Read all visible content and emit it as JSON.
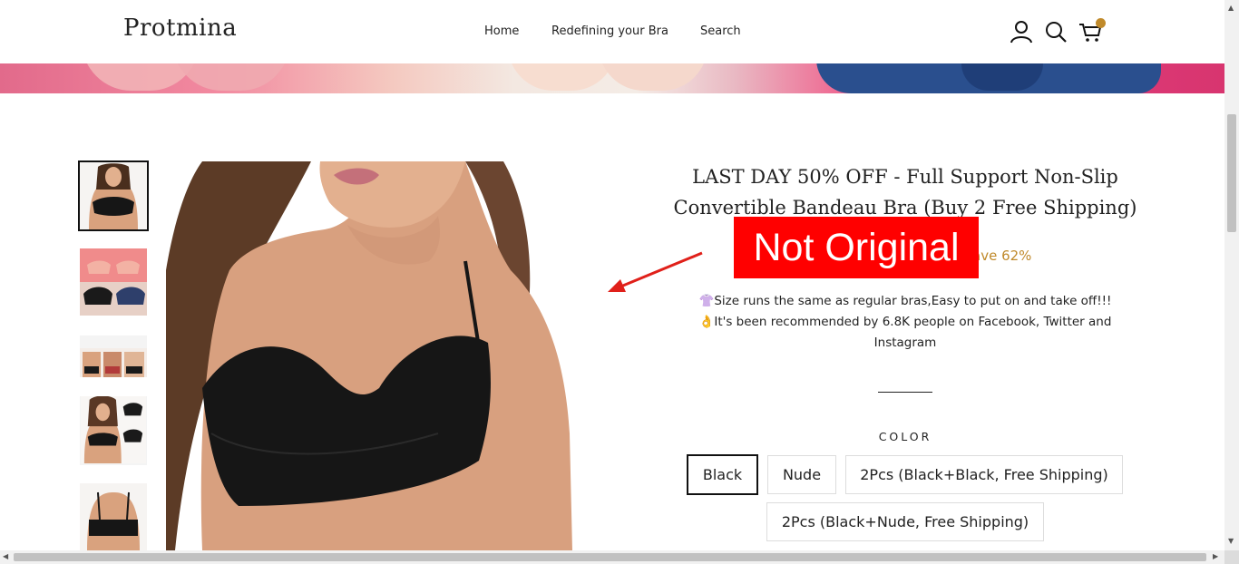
{
  "header": {
    "logo": "Protmina",
    "nav": [
      {
        "label": "Home"
      },
      {
        "label": "Redefining your Bra"
      },
      {
        "label": "Search"
      }
    ],
    "icons": [
      "account-icon",
      "search-icon",
      "cart-icon"
    ]
  },
  "product": {
    "title_line1": "LAST DAY 50% OFF - Full Support Non-Slip",
    "title_line2": "Convertible Bandeau Bra (Buy 2 Free Shipping)",
    "save_text": "ave 62%",
    "desc_line1": "👚Size runs the same as regular bras,Easy to put on and take off!!!",
    "desc_line2": "👌It's been recommended by 6.8K people on Facebook, Twitter and",
    "desc_line3": "Instagram",
    "color_label": "COLOR",
    "colors": [
      {
        "label": "Black",
        "selected": true
      },
      {
        "label": "Nude",
        "selected": false
      },
      {
        "label": "2Pcs (Black+Black, Free Shipping)",
        "selected": false
      },
      {
        "label": "2Pcs (Black+Nude, Free Shipping)",
        "selected": false
      }
    ]
  },
  "overlay": {
    "label": "Not Original",
    "color": "#ff0000"
  },
  "colors": {
    "accent": "#c08a2b",
    "text": "#222222"
  }
}
